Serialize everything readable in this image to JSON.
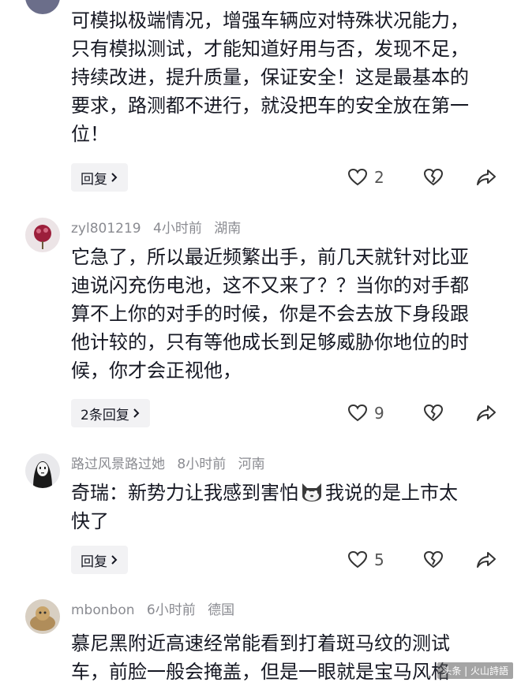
{
  "comments": [
    {
      "text_lines": [
        "可模拟极端情况，增强车辆应对特殊状况能力，",
        "只有模拟测试，才能知道好用与否，发现不足，",
        "持续改进，提升质量，保证安全！这是最基本的",
        "要求，路测都不进行，就没把车的安全放在第一",
        "位！"
      ],
      "reply_label": "回复",
      "likes": "2"
    },
    {
      "username": "zyl801219",
      "time": "4小时前",
      "location": "湖南",
      "text_lines": [
        "它急了，所以最近频繁出手，前几天就针对比亚",
        "迪说闪充伤电池，这不又来了？？当你的对手都",
        "算不上你的对手的时候，你是不会去放下身段跟",
        "他计较的，只有等他成长到足够威胁你地位的时",
        "候，你才会正视他，"
      ],
      "reply_label": "2条回复",
      "likes": "9"
    },
    {
      "username": "路过风景路过她",
      "time": "8小时前",
      "location": "河南",
      "text_lines": [
        "奇瑞：新势力让我感到害怕",
        "我说的是上市太",
        "快了"
      ],
      "emoji_icon": "cat-face-emoji-icon",
      "reply_label": "回复",
      "likes": "5"
    },
    {
      "username": "mbonbon",
      "time": "6小时前",
      "location": "德国",
      "text_lines": [
        "慕尼黑附近高速经常能看到打着斑马纹的测试",
        "车，前脸一般会掩盖，但是一眼就是宝马风格"
      ]
    }
  ],
  "icons": {
    "like": "heart-outline-icon",
    "dislike": "broken-heart-icon",
    "share": "share-arrow-icon",
    "chevron": "chevron-right-icon"
  },
  "watermark": "头条 | 火山詩語"
}
